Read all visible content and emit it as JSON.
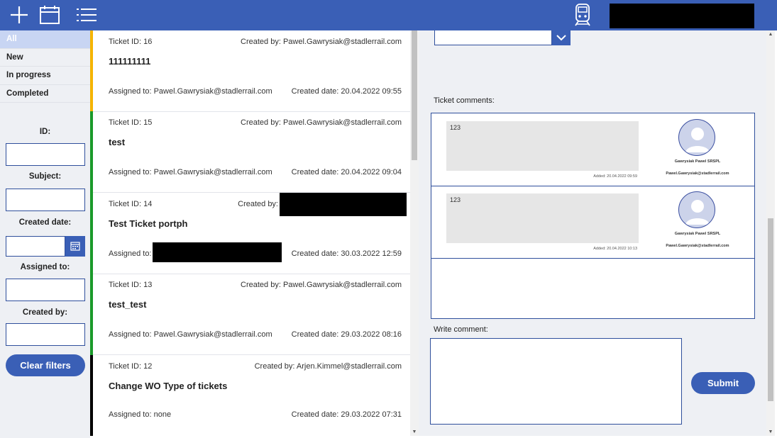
{
  "colors": {
    "accent": "#3a5fb6",
    "status_yellow": "#f5b400",
    "status_green": "#1a9a2a",
    "status_black": "#000000"
  },
  "toolbar": {
    "add_icon": "plus-icon",
    "calendar_icon": "calendar-icon",
    "list_icon": "list-icon",
    "logo_icon": "train-icon"
  },
  "filters": {
    "status_tabs": [
      "All",
      "New",
      "In progress",
      "Completed"
    ],
    "active_tab": "All",
    "id_label": "ID:",
    "subject_label": "Subject:",
    "created_date_label": "Created date:",
    "assigned_to_label": "Assigned to:",
    "created_by_label": "Created by:",
    "clear_label": "Clear filters"
  },
  "tickets": [
    {
      "id": "Ticket ID: 16",
      "created_by": "Created by: Pawel.Gawrysiak@stadlerrail.com",
      "subject": "111111111",
      "assigned": "Assigned to:  Pawel.Gawrysiak@stadlerrail.com",
      "date": "Created date: 20.04.2022 09:55",
      "status_color": "#f5b400"
    },
    {
      "id": "Ticket ID: 15",
      "created_by": "Created by: Pawel.Gawrysiak@stadlerrail.com",
      "subject": "test",
      "assigned": "Assigned to:  Pawel.Gawrysiak@stadlerrail.com",
      "date": "Created date: 20.04.2022 09:04",
      "status_color": "#1a9a2a"
    },
    {
      "id": "Ticket ID: 14",
      "created_by": "Created by:",
      "subject": "Test Ticket portph",
      "assigned": "Assigned to:",
      "date": "Created date: 30.03.2022 12:59",
      "status_color": "#1a9a2a"
    },
    {
      "id": "Ticket ID: 13",
      "created_by": "Created by: Pawel.Gawrysiak@stadlerrail.com",
      "subject": "test_test",
      "assigned": "Assigned to:  Pawel.Gawrysiak@stadlerrail.com",
      "date": "Created date: 29.03.2022 08:16",
      "status_color": "#1a9a2a"
    },
    {
      "id": "Ticket ID: 12",
      "created_by": "Created by: Arjen.Kimmel@stadlerrail.com",
      "subject": "Change WO Type of tickets",
      "assigned": "Assigned to:  none",
      "date": "Created date: 29.03.2022 07:31",
      "status_color": "#000000"
    }
  ],
  "detail": {
    "dropdown_value": "",
    "comments_label": "Ticket comments:",
    "write_label": "Write comment:",
    "write_value": "",
    "submit_label": "Submit",
    "comments": [
      {
        "text": "123",
        "added": "Added: 20.04.2022 09:59",
        "name": "Gawrysiak Pawel SRSPL",
        "email": "Pawel.Gawrysiak@stadlerrail.com",
        "avatar_icon": "person-icon"
      },
      {
        "text": "123",
        "added": "Added: 20.04.2022 10:13",
        "name": "Gawrysiak Pawel SRSPL",
        "email": "Pawel.Gawrysiak@stadlerrail.com",
        "avatar_icon": "person-icon"
      }
    ]
  }
}
